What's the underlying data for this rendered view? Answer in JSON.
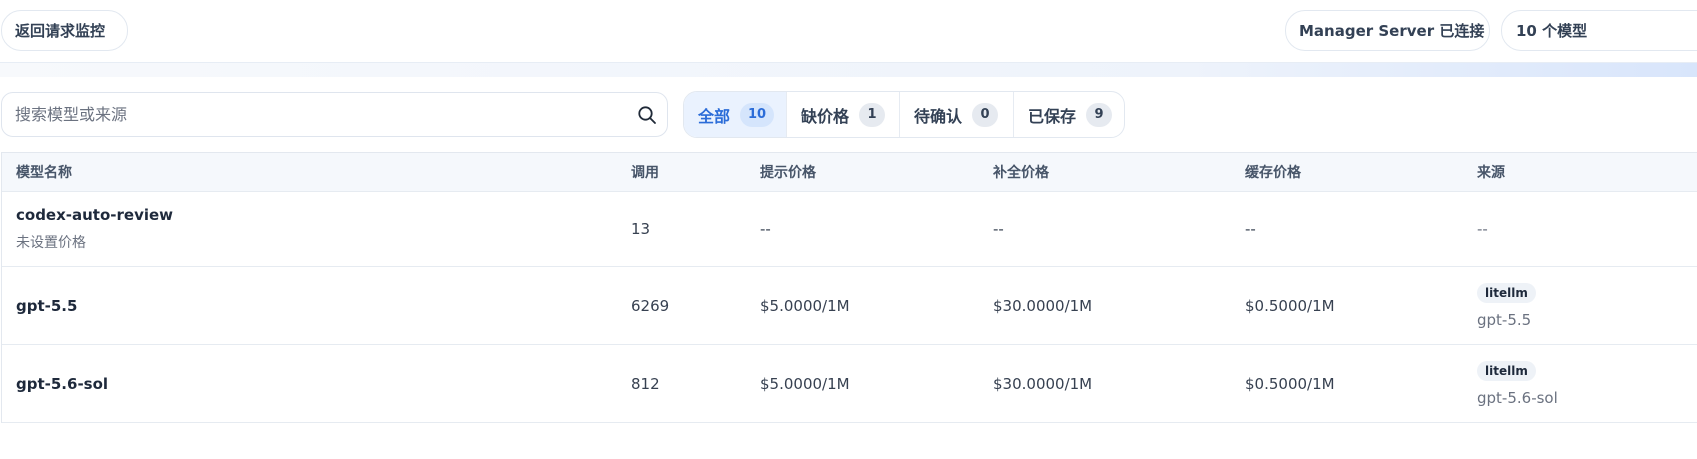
{
  "header": {
    "back_label": "返回请求监控",
    "server_status": "Manager Server 已连接",
    "model_count": "10 个模型"
  },
  "search": {
    "placeholder": "搜索模型或来源",
    "icon": "search-icon"
  },
  "filters": [
    {
      "label": "全部",
      "count": "10",
      "active": true
    },
    {
      "label": "缺价格",
      "count": "1",
      "active": false
    },
    {
      "label": "待确认",
      "count": "0",
      "active": false
    },
    {
      "label": "已保存",
      "count": "9",
      "active": false
    }
  ],
  "table": {
    "headers": {
      "name": "模型名称",
      "calls": "调用",
      "prompt_price": "提示价格",
      "completion_price": "补全价格",
      "cache_price": "缓存价格",
      "source": "来源"
    },
    "rows": [
      {
        "name": "codex-auto-review",
        "note": "未设置价格",
        "calls": "13",
        "prompt_price": "--",
        "completion_price": "--",
        "cache_price": "--",
        "source_badge": "",
        "source_model": "--"
      },
      {
        "name": "gpt-5.5",
        "note": "",
        "calls": "6269",
        "prompt_price": "$5.0000/1M",
        "completion_price": "$30.0000/1M",
        "cache_price": "$0.5000/1M",
        "source_badge": "litellm",
        "source_model": "gpt-5.5"
      },
      {
        "name": "gpt-5.6-sol",
        "note": "",
        "calls": "812",
        "prompt_price": "$5.0000/1M",
        "completion_price": "$30.0000/1M",
        "cache_price": "$0.5000/1M",
        "source_badge": "litellm",
        "source_model": "gpt-5.6-sol"
      }
    ]
  }
}
